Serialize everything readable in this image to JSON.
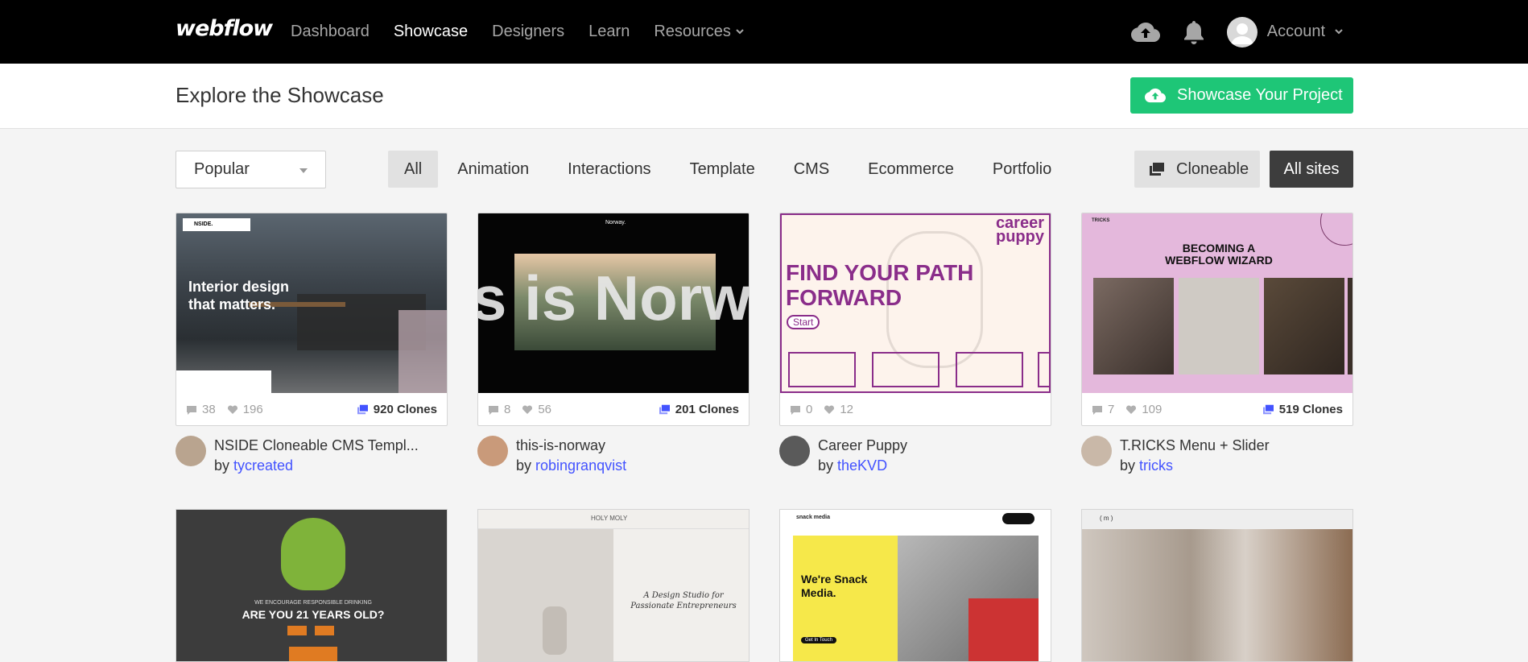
{
  "nav": {
    "logo": "webflow",
    "links": [
      {
        "label": "Dashboard",
        "active": false
      },
      {
        "label": "Showcase",
        "active": true
      },
      {
        "label": "Designers",
        "active": false
      },
      {
        "label": "Learn",
        "active": false
      },
      {
        "label": "Resources",
        "active": false
      }
    ],
    "account_label": "Account"
  },
  "header": {
    "title": "Explore the Showcase",
    "cta_label": "Showcase Your Project"
  },
  "filters": {
    "sort_value": "Popular",
    "tabs": [
      "All",
      "Animation",
      "Interactions",
      "Template",
      "CMS",
      "Ecommerce",
      "Portfolio"
    ],
    "active_tab": "All",
    "cloneable_label": "Cloneable",
    "allsites_label": "All sites"
  },
  "cards": [
    {
      "title": "NSIDE Cloneable CMS Templ...",
      "by": "by",
      "author": "tycreated",
      "comments": "38",
      "likes": "196",
      "clones": "920 Clones",
      "thumb_text": "Interior design that matters.",
      "brand": "NSIDE."
    },
    {
      "title": "this-is-norway",
      "by": "by",
      "author": "robingranqvist",
      "comments": "8",
      "likes": "56",
      "clones": "201 Clones",
      "thumb_text": "s is Norw",
      "brand": "Norway."
    },
    {
      "title": "Career Puppy",
      "by": "by",
      "author": "theKVD",
      "comments": "0",
      "likes": "12",
      "clones": "",
      "thumb_text": "FIND YOUR PATH FORWARD",
      "brand": "career puppy",
      "start": "Start"
    },
    {
      "title": "T.RICKS Menu + Slider",
      "by": "by",
      "author": "tricks",
      "comments": "7",
      "likes": "109",
      "clones": "519 Clones",
      "thumb_text": "BECOMING A WEBFLOW WIZARD",
      "brand": "TRICKS"
    }
  ],
  "row2": [
    {
      "heading": "ARE YOU 21 YEARS OLD?",
      "sub": "WE ENCOURAGE RESPONSIBLE DRINKING"
    },
    {
      "heading": "A Design Studio for Passionate Entrepreneurs",
      "brand": "HOLY MOLY"
    },
    {
      "heading": "We're Snack Media.",
      "cta": "Get In Touch",
      "brand": "snack media"
    },
    {
      "heading": "( m )"
    }
  ],
  "colors": {
    "accent_green": "#1ec677",
    "link_blue": "#4353ff",
    "nav_bg": "#000000"
  }
}
